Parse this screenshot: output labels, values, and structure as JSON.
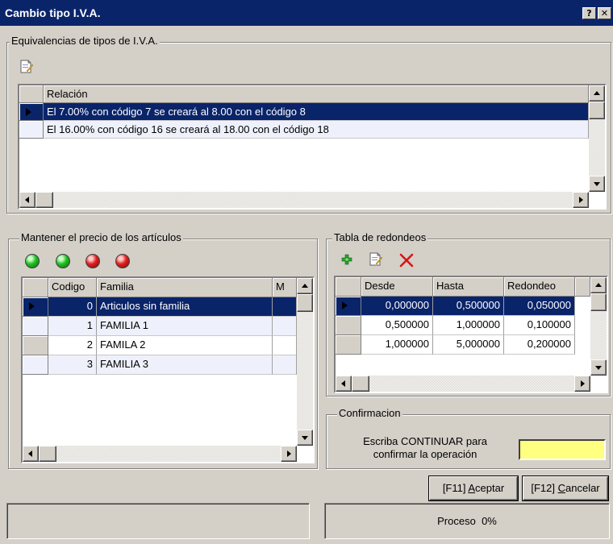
{
  "window": {
    "title": "Cambio tipo I.V.A.",
    "help_label": "?",
    "close_label": "✕"
  },
  "equivalencias": {
    "title": "Equivalencias de tipos de I.V.A.",
    "header": "Relación",
    "rows": [
      "El 7.00% con código 7 se creará al 8.00 con el código 8",
      "El 16.00% con código 16 se creará al 18.00 con el código 18"
    ]
  },
  "articulos": {
    "title": "Mantener el precio de los artículos",
    "leds": [
      "green",
      "green",
      "red",
      "red"
    ],
    "headers": [
      "Codigo",
      "Familia",
      "M"
    ],
    "rows": [
      {
        "codigo": "0",
        "familia": "Articulos sin familia"
      },
      {
        "codigo": "1",
        "familia": "FAMILIA 1"
      },
      {
        "codigo": "2",
        "familia": "FAMILA 2"
      },
      {
        "codigo": "3",
        "familia": "FAMILIA 3"
      }
    ]
  },
  "redondeos": {
    "title": "Tabla de redondeos",
    "headers": [
      "Desde",
      "Hasta",
      "Redondeo"
    ],
    "rows": [
      {
        "desde": "0,000000",
        "hasta": "0,500000",
        "redondeo": "0,050000"
      },
      {
        "desde": "0,500000",
        "hasta": "1,000000",
        "redondeo": "0,100000"
      },
      {
        "desde": "1,000000",
        "hasta": "5,000000",
        "redondeo": "0,200000"
      }
    ]
  },
  "confirmacion": {
    "title": "Confirmacion",
    "prompt_line1": "Escriba CONTINUAR para",
    "prompt_line2": "confirmar la operación",
    "value": "",
    "input_color": "#ffff80"
  },
  "buttons": {
    "accept_prefix": "[F11] ",
    "accept_key": "A",
    "accept_rest": "ceptar",
    "cancel_prefix": "[F12] ",
    "cancel_key": "C",
    "cancel_rest": "ancelar"
  },
  "status": {
    "progress_label": "Proceso",
    "progress_value": "0%"
  },
  "colors": {
    "selection": "#0a246a",
    "face": "#d4d0c8"
  }
}
